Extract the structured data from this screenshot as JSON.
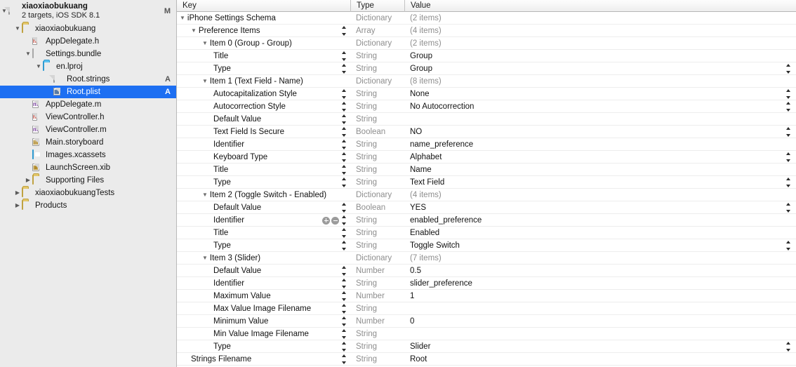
{
  "navigator": {
    "project": {
      "name": "xiaoxiaobukuang",
      "subtitle": "2 targets, iOS SDK 8.1",
      "badge": "M",
      "icon": "project-icon",
      "expanded": true
    },
    "items": [
      {
        "label": "xiaoxiaobukuang",
        "icon": "folder-icon",
        "indent": 1,
        "twisty": "down",
        "badge": "",
        "selected": false
      },
      {
        "label": "AppDelegate.h",
        "icon": "header-file-icon",
        "indent": 2,
        "twisty": "none",
        "badge": "",
        "selected": false
      },
      {
        "label": "Settings.bundle",
        "icon": "bundle-icon",
        "indent": 2,
        "twisty": "down",
        "badge": "",
        "selected": false
      },
      {
        "label": "en.lproj",
        "icon": "blue-folder-icon",
        "indent": 3,
        "twisty": "down",
        "badge": "",
        "selected": false
      },
      {
        "label": "Root.strings",
        "icon": "strings-file-icon",
        "indent": 4,
        "twisty": "none",
        "badge": "A",
        "selected": false
      },
      {
        "label": "Root.plist",
        "icon": "plist-file-icon",
        "indent": 4,
        "twisty": "none",
        "badge": "A",
        "selected": true
      },
      {
        "label": "AppDelegate.m",
        "icon": "source-file-icon",
        "indent": 2,
        "twisty": "none",
        "badge": "",
        "selected": false
      },
      {
        "label": "ViewController.h",
        "icon": "header-file-icon",
        "indent": 2,
        "twisty": "none",
        "badge": "",
        "selected": false
      },
      {
        "label": "ViewController.m",
        "icon": "source-file-icon",
        "indent": 2,
        "twisty": "none",
        "badge": "",
        "selected": false
      },
      {
        "label": "Main.storyboard",
        "icon": "storyboard-icon",
        "indent": 2,
        "twisty": "none",
        "badge": "",
        "selected": false
      },
      {
        "label": "Images.xcassets",
        "icon": "assets-icon",
        "indent": 2,
        "twisty": "none",
        "badge": "",
        "selected": false
      },
      {
        "label": "LaunchScreen.xib",
        "icon": "xib-icon",
        "indent": 2,
        "twisty": "none",
        "badge": "",
        "selected": false
      },
      {
        "label": "Supporting Files",
        "icon": "folder-icon",
        "indent": 2,
        "twisty": "right",
        "badge": "",
        "selected": false
      },
      {
        "label": "xiaoxiaobukuangTests",
        "icon": "folder-icon",
        "indent": 1,
        "twisty": "right",
        "badge": "",
        "selected": false
      },
      {
        "label": "Products",
        "icon": "folder-icon",
        "indent": 1,
        "twisty": "right",
        "badge": "",
        "selected": false
      }
    ]
  },
  "table": {
    "columns": {
      "key": "Key",
      "type": "Type",
      "value": "Value"
    },
    "rows": [
      {
        "key": "iPhone Settings Schema",
        "indent": 0,
        "twisty": "down",
        "type": "Dictionary",
        "value": "(2 items)",
        "value_muted": true,
        "key_stepper": false,
        "value_stepper": false,
        "pm_buttons": false
      },
      {
        "key": "Preference Items",
        "indent": 1,
        "twisty": "down",
        "type": "Array",
        "value": "(4 items)",
        "value_muted": true,
        "key_stepper": true,
        "value_stepper": false,
        "pm_buttons": false
      },
      {
        "key": "Item 0 (Group - Group)",
        "indent": 2,
        "twisty": "down",
        "type": "Dictionary",
        "value": "(2 items)",
        "value_muted": true,
        "key_stepper": false,
        "value_stepper": false,
        "pm_buttons": false
      },
      {
        "key": "Title",
        "indent": 3,
        "twisty": "none",
        "type": "String",
        "value": "Group",
        "value_muted": false,
        "key_stepper": true,
        "value_stepper": false,
        "pm_buttons": false
      },
      {
        "key": "Type",
        "indent": 3,
        "twisty": "none",
        "type": "String",
        "value": "Group",
        "value_muted": false,
        "key_stepper": true,
        "value_stepper": true,
        "pm_buttons": false
      },
      {
        "key": "Item 1 (Text Field - Name)",
        "indent": 2,
        "twisty": "down",
        "type": "Dictionary",
        "value": "(8 items)",
        "value_muted": true,
        "key_stepper": false,
        "value_stepper": false,
        "pm_buttons": false
      },
      {
        "key": "Autocapitalization Style",
        "indent": 3,
        "twisty": "none",
        "type": "String",
        "value": "None",
        "value_muted": false,
        "key_stepper": true,
        "value_stepper": true,
        "pm_buttons": false
      },
      {
        "key": "Autocorrection Style",
        "indent": 3,
        "twisty": "none",
        "type": "String",
        "value": "No Autocorrection",
        "value_muted": false,
        "key_stepper": true,
        "value_stepper": true,
        "pm_buttons": false
      },
      {
        "key": "Default Value",
        "indent": 3,
        "twisty": "none",
        "type": "String",
        "value": "",
        "value_muted": false,
        "key_stepper": true,
        "value_stepper": false,
        "pm_buttons": false
      },
      {
        "key": "Text Field Is Secure",
        "indent": 3,
        "twisty": "none",
        "type": "Boolean",
        "value": "NO",
        "value_muted": false,
        "key_stepper": true,
        "value_stepper": true,
        "pm_buttons": false
      },
      {
        "key": "Identifier",
        "indent": 3,
        "twisty": "none",
        "type": "String",
        "value": "name_preference",
        "value_muted": false,
        "key_stepper": true,
        "value_stepper": false,
        "pm_buttons": false
      },
      {
        "key": "Keyboard Type",
        "indent": 3,
        "twisty": "none",
        "type": "String",
        "value": "Alphabet",
        "value_muted": false,
        "key_stepper": true,
        "value_stepper": true,
        "pm_buttons": false
      },
      {
        "key": "Title",
        "indent": 3,
        "twisty": "none",
        "type": "String",
        "value": "Name",
        "value_muted": false,
        "key_stepper": true,
        "value_stepper": false,
        "pm_buttons": false
      },
      {
        "key": "Type",
        "indent": 3,
        "twisty": "none",
        "type": "String",
        "value": "Text Field",
        "value_muted": false,
        "key_stepper": true,
        "value_stepper": true,
        "pm_buttons": false
      },
      {
        "key": "Item 2 (Toggle Switch - Enabled)",
        "indent": 2,
        "twisty": "down",
        "type": "Dictionary",
        "value": "(4 items)",
        "value_muted": true,
        "key_stepper": false,
        "value_stepper": false,
        "pm_buttons": false
      },
      {
        "key": "Default Value",
        "indent": 3,
        "twisty": "none",
        "type": "Boolean",
        "value": "YES",
        "value_muted": false,
        "key_stepper": true,
        "value_stepper": true,
        "pm_buttons": false
      },
      {
        "key": "Identifier",
        "indent": 3,
        "twisty": "none",
        "type": "String",
        "value": "enabled_preference",
        "value_muted": false,
        "key_stepper": true,
        "value_stepper": false,
        "pm_buttons": true
      },
      {
        "key": "Title",
        "indent": 3,
        "twisty": "none",
        "type": "String",
        "value": "Enabled",
        "value_muted": false,
        "key_stepper": true,
        "value_stepper": false,
        "pm_buttons": false
      },
      {
        "key": "Type",
        "indent": 3,
        "twisty": "none",
        "type": "String",
        "value": "Toggle Switch",
        "value_muted": false,
        "key_stepper": true,
        "value_stepper": true,
        "pm_buttons": false
      },
      {
        "key": "Item 3 (Slider)",
        "indent": 2,
        "twisty": "down",
        "type": "Dictionary",
        "value": "(7 items)",
        "value_muted": true,
        "key_stepper": false,
        "value_stepper": false,
        "pm_buttons": false
      },
      {
        "key": "Default Value",
        "indent": 3,
        "twisty": "none",
        "type": "Number",
        "value": "0.5",
        "value_muted": false,
        "key_stepper": true,
        "value_stepper": false,
        "pm_buttons": false
      },
      {
        "key": "Identifier",
        "indent": 3,
        "twisty": "none",
        "type": "String",
        "value": "slider_preference",
        "value_muted": false,
        "key_stepper": true,
        "value_stepper": false,
        "pm_buttons": false
      },
      {
        "key": "Maximum Value",
        "indent": 3,
        "twisty": "none",
        "type": "Number",
        "value": "1",
        "value_muted": false,
        "key_stepper": true,
        "value_stepper": false,
        "pm_buttons": false
      },
      {
        "key": "Max Value Image Filename",
        "indent": 3,
        "twisty": "none",
        "type": "String",
        "value": "",
        "value_muted": false,
        "key_stepper": true,
        "value_stepper": false,
        "pm_buttons": false
      },
      {
        "key": "Minimum Value",
        "indent": 3,
        "twisty": "none",
        "type": "Number",
        "value": "0",
        "value_muted": false,
        "key_stepper": true,
        "value_stepper": false,
        "pm_buttons": false
      },
      {
        "key": "Min Value Image Filename",
        "indent": 3,
        "twisty": "none",
        "type": "String",
        "value": "",
        "value_muted": false,
        "key_stepper": true,
        "value_stepper": false,
        "pm_buttons": false
      },
      {
        "key": "Type",
        "indent": 3,
        "twisty": "none",
        "type": "String",
        "value": "Slider",
        "value_muted": false,
        "key_stepper": true,
        "value_stepper": true,
        "pm_buttons": false
      },
      {
        "key": "Strings Filename",
        "indent": 1,
        "twisty": "none",
        "type": "String",
        "value": "Root",
        "value_muted": false,
        "key_stepper": true,
        "value_stepper": false,
        "pm_buttons": false
      }
    ]
  },
  "colors": {
    "selection": "#1d6ff2",
    "sidebar_bg": "#ebebeb",
    "muted_text": "#8e8e8e",
    "row_separator": "#ededed"
  }
}
